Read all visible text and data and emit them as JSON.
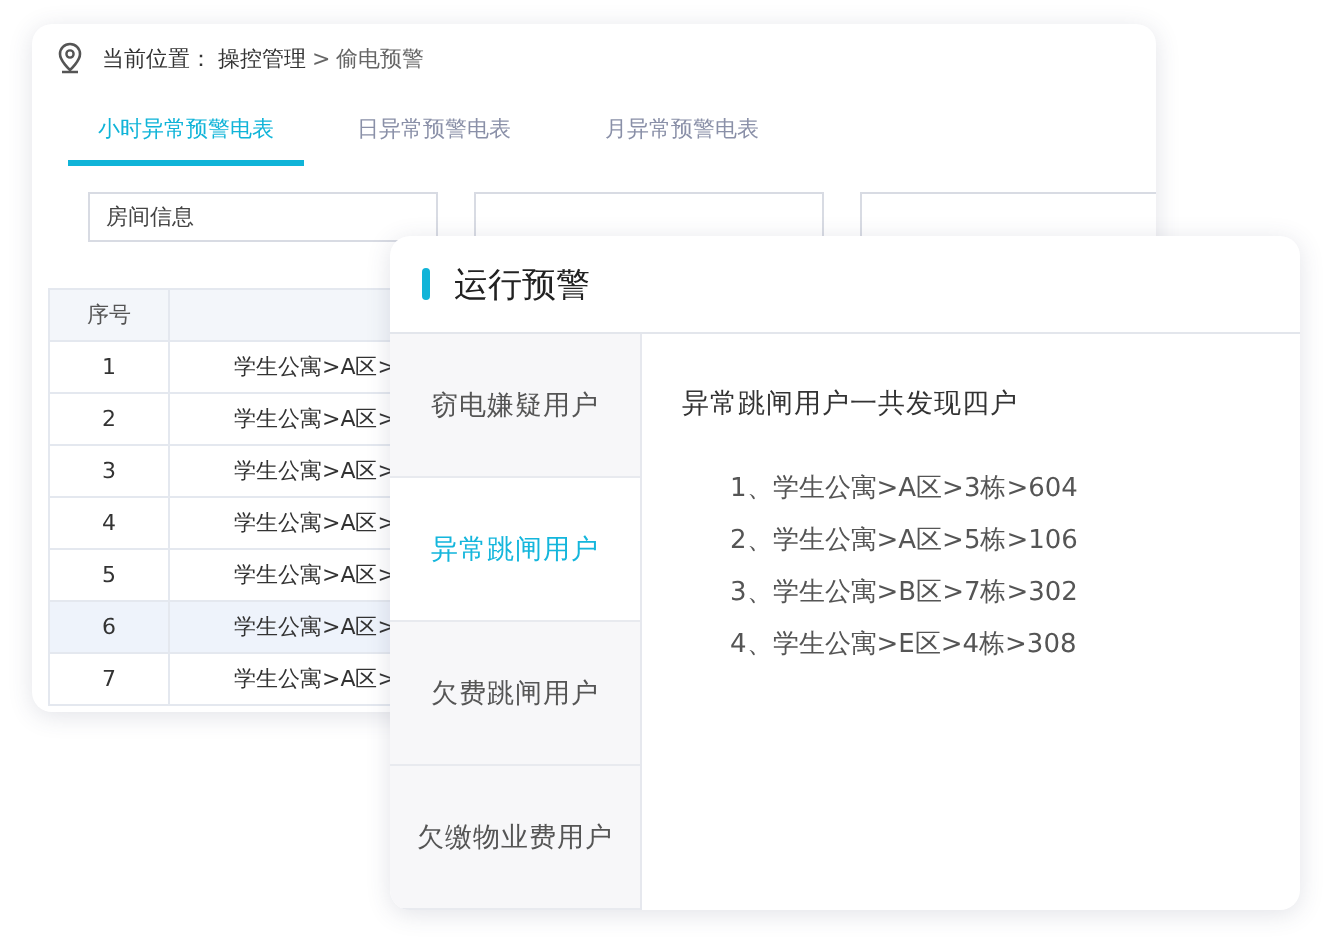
{
  "breadcrumb": {
    "label": "当前位置：",
    "path": "操控管理",
    "separator": ">",
    "current": "偷电预警"
  },
  "tabs": [
    {
      "label": "小时异常预警电表",
      "selected": true
    },
    {
      "label": "日异常预警电表",
      "selected": false
    },
    {
      "label": "月异常预警电表",
      "selected": false
    }
  ],
  "filter": {
    "placeholder": "房间信息"
  },
  "table": {
    "columns": [
      "序号"
    ],
    "rows": [
      {
        "index": "1",
        "room": "学生公寓>A区>",
        "selected": false
      },
      {
        "index": "2",
        "room": "学生公寓>A区>",
        "selected": false
      },
      {
        "index": "3",
        "room": "学生公寓>A区>",
        "selected": false
      },
      {
        "index": "4",
        "room": "学生公寓>A区>",
        "selected": false
      },
      {
        "index": "5",
        "room": "学生公寓>A区>",
        "selected": false
      },
      {
        "index": "6",
        "room": "学生公寓>A区>",
        "selected": true
      },
      {
        "index": "7",
        "room": "学生公寓>A区>",
        "selected": false
      }
    ]
  },
  "dialog": {
    "title": "运行预警",
    "categories": [
      {
        "label": "窃电嫌疑用户",
        "selected": false
      },
      {
        "label": "异常跳闸用户",
        "selected": true
      },
      {
        "label": "欠费跳闸用户",
        "selected": false
      },
      {
        "label": "欠缴物业费用户",
        "selected": false
      }
    ],
    "summary": "异常跳闸用户一共发现四户",
    "items": [
      "1、学生公寓>A区>3栋>604",
      "2、学生公寓>A区>5栋>106",
      "3、学生公寓>B区>7栋>302",
      "4、学生公寓>E区>4栋>308"
    ]
  }
}
